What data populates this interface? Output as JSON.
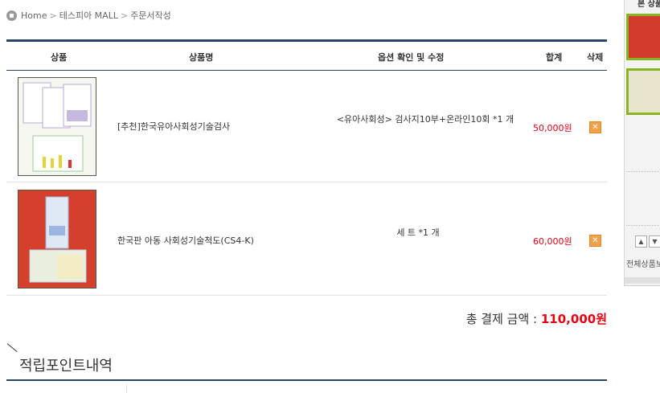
{
  "breadcrumb": {
    "home": "Home",
    "mall": "테스피아 MALL",
    "current": "주문서작성",
    "sep": ">"
  },
  "table": {
    "headers": {
      "product": "상품",
      "name": "상품명",
      "option": "옵션 확인 및 수정",
      "total": "합계",
      "delete": "삭제"
    },
    "rows": [
      {
        "name": "[추천]한국유아사회성기술검사",
        "option": "<유아사회성> 검사지10부+온라인10회 *1 개",
        "price": "50,000원"
      },
      {
        "name": "한국판 아동 사회성기술척도(CS4-K)",
        "option": "세 트 *1 개",
        "price": "60,000원"
      }
    ]
  },
  "total": {
    "label": "총 결제 금액 :",
    "amount": "110,000원"
  },
  "points": {
    "title": "적립포인트내역"
  },
  "side_panel": {
    "title": "본 상품",
    "all_link": "전체상품보"
  },
  "colors": {
    "accent_navy": "#2d4465",
    "price_red": "#e60012",
    "thumb_border_green": "#8ab522"
  }
}
